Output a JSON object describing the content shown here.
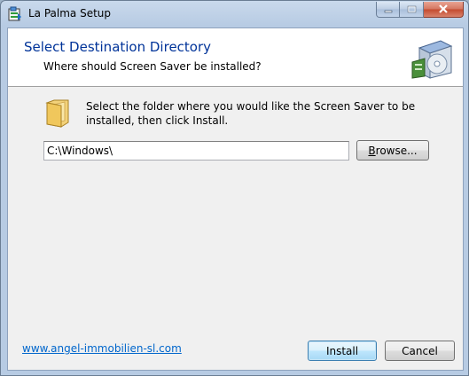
{
  "window": {
    "title": "La Palma Setup",
    "icons": {
      "app": "setup-app-icon",
      "minimize": "minimize-icon",
      "maximize": "maximize-icon",
      "close": "close-icon"
    }
  },
  "header": {
    "title": "Select Destination Directory",
    "subtitle": "Where should Screen Saver be installed?",
    "graphic": "installer-box-icon"
  },
  "body": {
    "folder_icon": "folder-icon",
    "instruction": "Select the folder where you would like the Screen Saver to be installed, then click Install.",
    "path_value": "C:\\Windows\\",
    "browse_label_underlined": "B",
    "browse_label_rest": "rowse..."
  },
  "footer": {
    "link_text": "www.angel-immobilien-sl.com",
    "install_label": "Install",
    "cancel_label": "Cancel"
  },
  "colors": {
    "header_title": "#003399",
    "link": "#0066cc",
    "close_button": "#c44a2e",
    "frame": "#b7cbe3"
  }
}
